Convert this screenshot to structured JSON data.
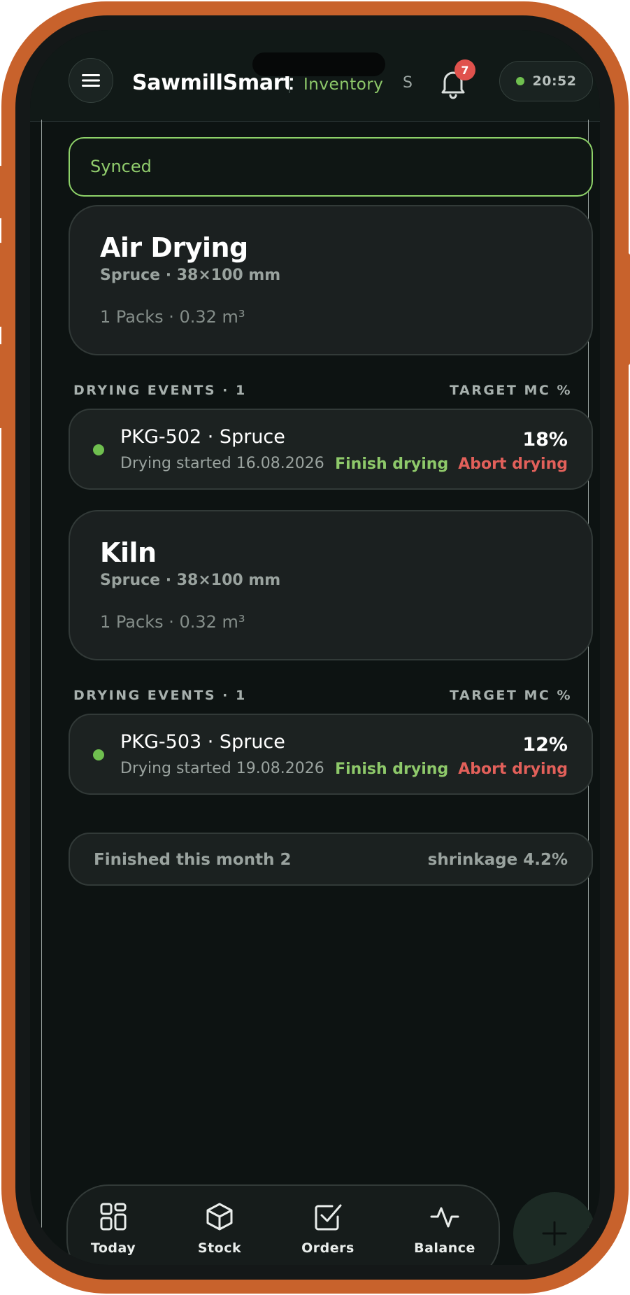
{
  "app": {
    "brand": "SawmillSmart",
    "section": "Inventory",
    "user_initial": "S",
    "notification_count": "7",
    "time": "20:52",
    "status_color": "#6fbf4f",
    "accent_green": "#8ec96a",
    "accent_red": "#e2605a",
    "frame_color": "#c8622c"
  },
  "sync": {
    "label": "Synced"
  },
  "groups": [
    {
      "title": "Air Drying",
      "subtitle": "Spruce · 38×100 mm",
      "meta": "1 Packs · 0.32 m³",
      "events_label": "DRYING EVENTS · 1",
      "target_label": "TARGET MC %",
      "event": {
        "title": "PKG-502 · Spruce",
        "subtitle": "Drying started 16.08.2026",
        "target": "18%",
        "finish": "Finish drying",
        "abort": "Abort drying"
      }
    },
    {
      "title": "Kiln",
      "subtitle": "Spruce · 38×100 mm",
      "meta": "1 Packs · 0.32 m³",
      "events_label": "DRYING EVENTS · 1",
      "target_label": "TARGET MC %",
      "event": {
        "title": "PKG-503 · Spruce",
        "subtitle": "Drying started 19.08.2026",
        "target": "12%",
        "finish": "Finish drying",
        "abort": "Abort drying"
      }
    }
  ],
  "summary": {
    "left": "Finished this month 2",
    "right": "shrinkage 4.2%"
  },
  "nav": {
    "items": [
      {
        "label": "Today",
        "icon": "grid-icon"
      },
      {
        "label": "Stock",
        "icon": "box-icon"
      },
      {
        "label": "Orders",
        "icon": "checkbox-icon"
      },
      {
        "label": "Balance",
        "icon": "pulse-icon"
      }
    ],
    "fab_icon": "plus-icon"
  }
}
